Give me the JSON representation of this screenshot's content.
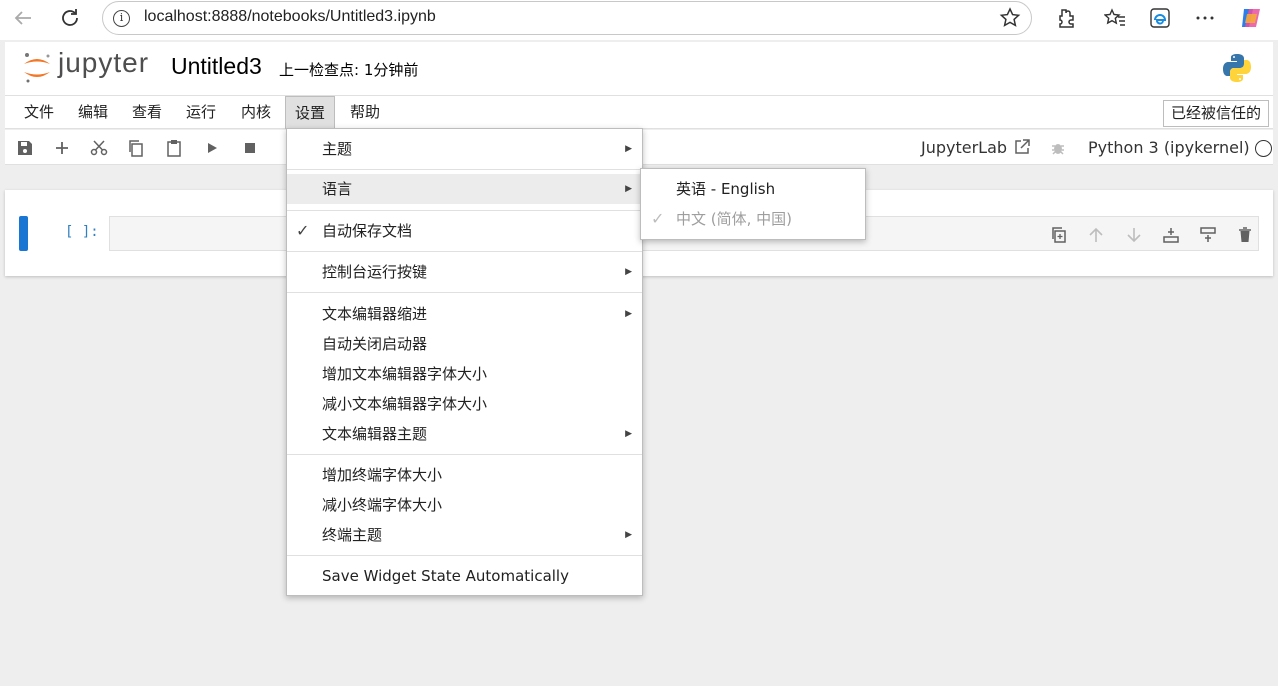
{
  "browser": {
    "url": "localhost:8888/notebooks/Untitled3.ipynb"
  },
  "header": {
    "logo_text": "jupyter",
    "notebook_title": "Untitled3",
    "checkpoint": "上一检查点: 1分钟前"
  },
  "menubar": {
    "items": [
      "文件",
      "编辑",
      "查看",
      "运行",
      "内核",
      "设置",
      "帮助"
    ],
    "active": "设置",
    "trusted_label": "已经被信任的"
  },
  "toolbar": {
    "jupyterlab_label": "JupyterLab",
    "kernel_label": "Python 3 (ipykernel)"
  },
  "cell": {
    "prompt": "[ ]:"
  },
  "settings_menu": {
    "items": [
      {
        "label": "主题",
        "submenu": true
      },
      {
        "label": "语言",
        "submenu": true,
        "highlighted": true
      },
      {
        "label": "自动保存文档",
        "checked": true
      },
      {
        "label": "控制台运行按键",
        "submenu": true
      },
      {
        "label": "文本编辑器缩进",
        "submenu": true
      },
      {
        "label": "自动关闭启动器"
      },
      {
        "label": "增加文本编辑器字体大小"
      },
      {
        "label": "减小文本编辑器字体大小"
      },
      {
        "label": "文本编辑器主题",
        "submenu": true
      },
      {
        "label": "增加终端字体大小"
      },
      {
        "label": "减小终端字体大小"
      },
      {
        "label": "终端主题",
        "submenu": true
      },
      {
        "label": "Save Widget State Automatically"
      }
    ]
  },
  "language_submenu": {
    "items": [
      {
        "label": "英语 - English"
      },
      {
        "label": "中文 (简体, 中国)",
        "checked": true,
        "disabled": true
      }
    ]
  },
  "colors": {
    "accent": "#1976d2",
    "prompt": "#307fc1",
    "logo_orange": "#f37726"
  }
}
